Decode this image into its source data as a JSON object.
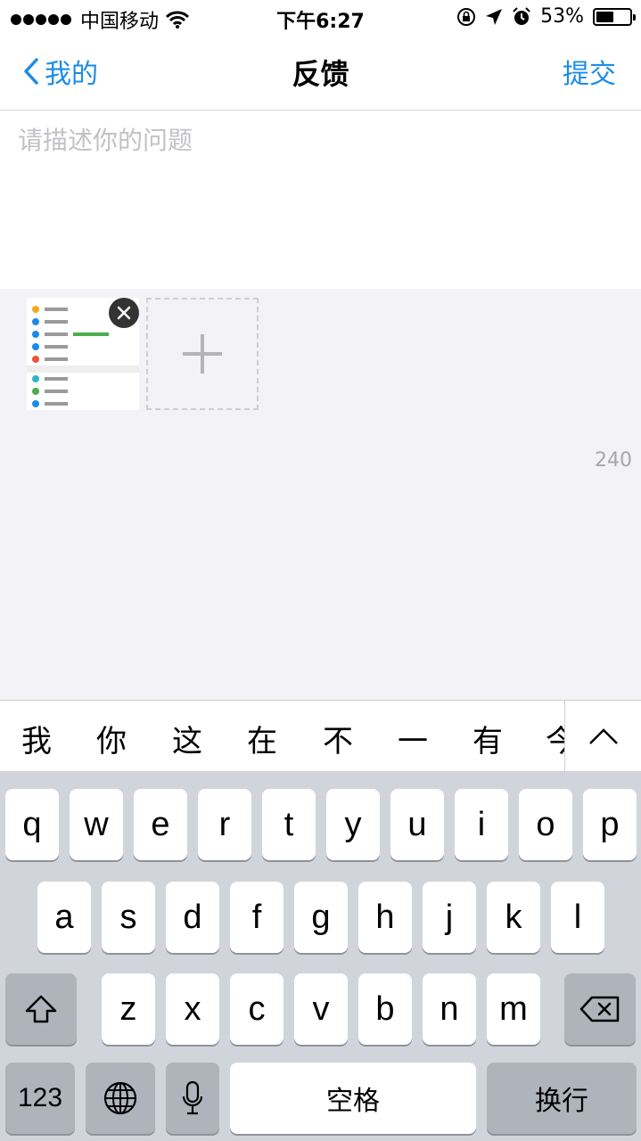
{
  "status_bar": {
    "carrier": "中国移动",
    "time": "下午6:27",
    "battery_text": "53%",
    "battery_level": 0.53,
    "signal_icon": "signal-dots-icon",
    "wifi_icon": "wifi-icon",
    "orientation_lock_icon": "orientation-lock-icon",
    "location_icon": "location-arrow-icon",
    "alarm_icon": "alarm-clock-icon"
  },
  "nav": {
    "back_label": "我的",
    "title": "反馈",
    "submit_label": "提交",
    "accent_color": "#1b8ce6"
  },
  "form": {
    "placeholder": "请描述你的问题",
    "char_count": "240"
  },
  "candidates": [
    "我",
    "你",
    "这",
    "在",
    "不",
    "一",
    "有",
    "今"
  ],
  "keyboard": {
    "row1": [
      "q",
      "w",
      "e",
      "r",
      "t",
      "y",
      "u",
      "i",
      "o",
      "p"
    ],
    "row2": [
      "a",
      "s",
      "d",
      "f",
      "g",
      "h",
      "j",
      "k",
      "l"
    ],
    "row3": [
      "z",
      "x",
      "c",
      "v",
      "b",
      "n",
      "m"
    ],
    "numbers_label": "123",
    "space_label": "空格",
    "return_label": "换行"
  }
}
